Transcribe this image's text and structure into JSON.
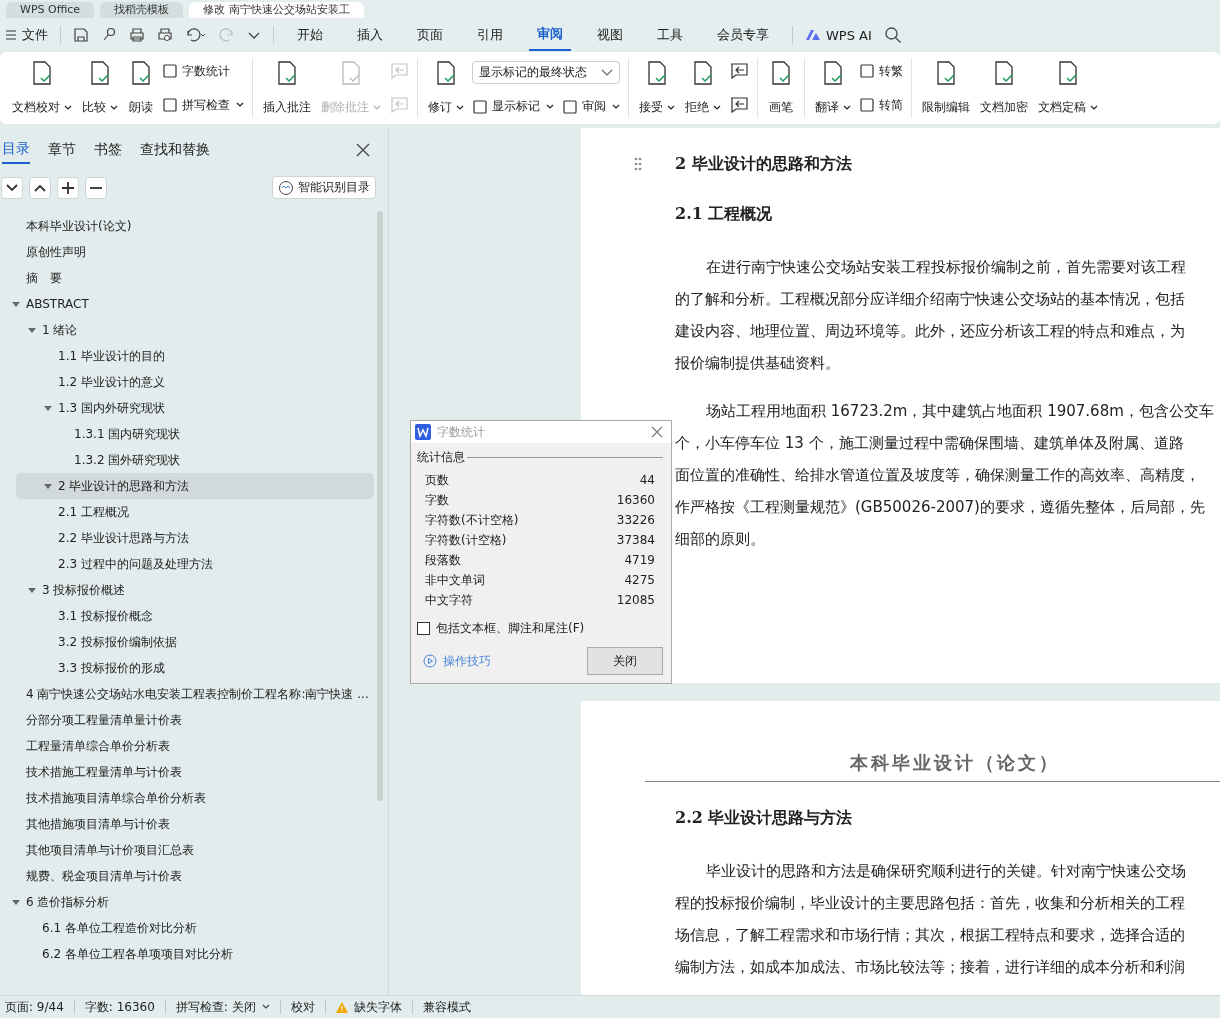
{
  "app_tabs": [
    {
      "label": "WPS Office",
      "selected": false
    },
    {
      "label": "找稻壳模板",
      "selected": false
    },
    {
      "label": "修改 南宁快速公交场站安装工",
      "selected": true
    }
  ],
  "menu": {
    "file": "文件",
    "tabs": [
      {
        "label": "开始",
        "selected": false
      },
      {
        "label": "插入",
        "selected": false
      },
      {
        "label": "页面",
        "selected": false
      },
      {
        "label": "引用",
        "selected": false
      },
      {
        "label": "审阅",
        "selected": true
      },
      {
        "label": "视图",
        "selected": false
      },
      {
        "label": "工具",
        "selected": false
      },
      {
        "label": "会员专享",
        "selected": false
      }
    ],
    "ai": "WPS AI"
  },
  "ribbon": {
    "groups": [
      {
        "items": [
          {
            "kind": "large",
            "label": "文档校对",
            "dropdown": true,
            "disabled": false
          },
          {
            "kind": "large",
            "label": "比较",
            "dropdown": true,
            "disabled": false
          },
          {
            "kind": "large",
            "label": "朗读",
            "dropdown": false,
            "disabled": false
          },
          {
            "kind": "column",
            "items": [
              {
                "kind": "small",
                "label": "字数统计",
                "dropdown": false
              },
              {
                "kind": "small",
                "label": "拼写检查",
                "dropdown": true
              }
            ]
          }
        ]
      },
      {
        "items": [
          {
            "kind": "large",
            "label": "插入批注",
            "dropdown": false,
            "disabled": false
          },
          {
            "kind": "large",
            "label": "删除批注",
            "dropdown": true,
            "disabled": true
          },
          {
            "kind": "column",
            "items": [
              {
                "kind": "icon",
                "disabled": true
              },
              {
                "kind": "icon",
                "disabled": true
              }
            ]
          }
        ]
      },
      {
        "items": [
          {
            "kind": "large",
            "label": "修订",
            "dropdown": true,
            "disabled": false
          },
          {
            "kind": "column",
            "items": [
              {
                "kind": "select",
                "value": "显示标记的最终状态"
              },
              {
                "kind": "row",
                "items": [
                  {
                    "label": "显示标记",
                    "dropdown": true
                  },
                  {
                    "label": "审阅",
                    "dropdown": true
                  }
                ]
              }
            ]
          }
        ]
      },
      {
        "items": [
          {
            "kind": "large",
            "label": "接受",
            "dropdown": true,
            "disabled": false
          },
          {
            "kind": "large",
            "label": "拒绝",
            "dropdown": true,
            "disabled": false
          },
          {
            "kind": "column",
            "items": [
              {
                "kind": "icon",
                "disabled": false
              },
              {
                "kind": "icon",
                "disabled": false
              }
            ]
          }
        ]
      },
      {
        "items": [
          {
            "kind": "large",
            "label": "画笔",
            "dropdown": false,
            "disabled": false
          }
        ]
      },
      {
        "items": [
          {
            "kind": "large",
            "label": "翻译",
            "dropdown": true,
            "disabled": false
          },
          {
            "kind": "column",
            "items": [
              {
                "kind": "small",
                "label": "转繁",
                "dropdown": false
              },
              {
                "kind": "small",
                "label": "转简",
                "dropdown": false
              }
            ]
          }
        ]
      },
      {
        "items": [
          {
            "kind": "large",
            "label": "限制编辑",
            "dropdown": false,
            "disabled": false
          },
          {
            "kind": "large",
            "label": "文档加密",
            "dropdown": false,
            "disabled": false
          },
          {
            "kind": "large",
            "label": "文档定稿",
            "dropdown": true,
            "disabled": false
          }
        ]
      }
    ]
  },
  "sidebar": {
    "tabs": [
      {
        "label": "目录",
        "selected": true
      },
      {
        "label": "章节",
        "selected": false
      },
      {
        "label": "书签",
        "selected": false
      },
      {
        "label": "查找和替换",
        "selected": false
      }
    ],
    "smart_button": "智能识别目录",
    "toc": [
      {
        "label": "本科毕业设计(论文)",
        "selected": false
      },
      {
        "label": "原创性声明",
        "selected": false
      },
      {
        "label": "摘　要",
        "selected": false
      },
      {
        "label": "ABSTRACT",
        "selected": false,
        "expanded": true,
        "children": [
          {
            "label": "1  绪论",
            "selected": false,
            "expanded": true,
            "children": [
              {
                "label": "1.1  毕业设计的目的",
                "selected": false
              },
              {
                "label": "1.2  毕业设计的意义",
                "selected": false
              },
              {
                "label": "1.3  国内外研究现状",
                "selected": false,
                "expanded": true,
                "children": [
                  {
                    "label": "1.3.1  国内研究现状",
                    "selected": false
                  },
                  {
                    "label": "1.3.2  国外研究现状",
                    "selected": false
                  }
                ]
              }
            ]
          },
          {
            "label": "2  毕业设计的思路和方法",
            "selected": true,
            "expanded": true,
            "children": [
              {
                "label": "2.1  工程概况",
                "selected": false
              },
              {
                "label": "2.2  毕业设计思路与方法",
                "selected": false
              },
              {
                "label": "2.3  过程中的问题及处理方法",
                "selected": false
              }
            ]
          },
          {
            "label": "3  投标报价概述",
            "selected": false,
            "expanded": true,
            "children": [
              {
                "label": "3.1  投标报价概念",
                "selected": false
              },
              {
                "label": "3.2  投标报价编制依据",
                "selected": false
              },
              {
                "label": "3.3  投标报价的形成",
                "selected": false
              }
            ]
          }
        ]
      },
      {
        "label": "4 南宁快速公交场站水电安装工程表控制价工程名称:南宁快速 ...",
        "selected": false
      },
      {
        "label": "分部分项工程量清单量计价表",
        "selected": false
      },
      {
        "label": "工程量清单综合单价分析表",
        "selected": false
      },
      {
        "label": "技术措施工程量清单与计价表",
        "selected": false
      },
      {
        "label": "技术措施项目清单综合单价分析表",
        "selected": false
      },
      {
        "label": "其他措施项目清单与计价表",
        "selected": false
      },
      {
        "label": "其他项目清单与计价项目汇总表",
        "selected": false
      },
      {
        "label": "规费、税金项目清单与计价表",
        "selected": false
      },
      {
        "label": "6  造价指标分析",
        "selected": false,
        "expanded": true,
        "children": [
          {
            "label": "6.1  各单位工程造价对比分析",
            "selected": false
          },
          {
            "label": "6.2  各单位工程各单项项目对比分析",
            "selected": false
          }
        ]
      }
    ]
  },
  "document": {
    "pages": [
      {
        "blocks": [
          {
            "kind": "h1",
            "text": "2  毕业设计的思路和方法"
          },
          {
            "kind": "h2",
            "text": "2.1  工程概况"
          },
          {
            "kind": "para",
            "lines": [
              "在进行南宁快速公交场站安装工程投标报价编制之前，首先需要对该工程",
              "的了解和分析。工程概况部分应详细介绍南宁快速公交场站的基本情况，包括",
              "建设内容、地理位置、周边环境等。此外，还应分析该工程的特点和难点，为",
              "报价编制提供基础资料。"
            ]
          },
          {
            "kind": "para",
            "lines": [
              "场站工程用地面积 16723.2m，其中建筑占地面积 1907.68m，包含公交车",
              "个，小车停车位 13 个，施工测量过程中需确保围墙、建筑单体及附属、道路",
              "面位置的准确性、给排水管道位置及坡度等，确保测量工作的高效率、高精度，",
              "作严格按《工程测量规范》(GB50026-2007)的要求，遵循先整体，后局部，先",
              "细部的原则。"
            ]
          }
        ]
      },
      {
        "blocks": [
          {
            "kind": "header",
            "text": "本科毕业设计（论文）"
          },
          {
            "kind": "h2",
            "text": "2.2  毕业设计思路与方法"
          },
          {
            "kind": "para",
            "lines": [
              "毕业设计的思路和方法是确保研究顺利进行的关键。针对南宁快速公交场",
              "程的投标报价编制，毕业设计的主要思路包括：首先，收集和分析相关的工程",
              "场信息，了解工程需求和市场行情；其次，根据工程特点和要求，选择合适的",
              "编制方法，如成本加成法、市场比较法等；接着，进行详细的成本分析和利润"
            ]
          }
        ]
      }
    ]
  },
  "dialog": {
    "title": "字数统计",
    "section": "统计信息",
    "rows": [
      {
        "label": "页数",
        "value": "44"
      },
      {
        "label": "字数",
        "value": "16360"
      },
      {
        "label": "字符数(不计空格)",
        "value": "33226"
      },
      {
        "label": "字符数(计空格)",
        "value": "37384"
      },
      {
        "label": "段落数",
        "value": "4719"
      },
      {
        "label": "非中文单词",
        "value": "4275"
      },
      {
        "label": "中文字符",
        "value": "12085"
      }
    ],
    "checkbox": {
      "label": "包括文本框、脚注和尾注(F)",
      "checked": false
    },
    "tips_link": "操作技巧",
    "close_button": "关闭"
  },
  "status_bar": [
    {
      "kind": "text",
      "text": "页面: 9/44"
    },
    {
      "kind": "text",
      "text": "字数: 16360"
    },
    {
      "kind": "dropdown",
      "text": "拼写检查: 关闭"
    },
    {
      "kind": "text",
      "text": "校对"
    },
    {
      "kind": "warning",
      "text": "缺失字体"
    },
    {
      "kind": "text",
      "text": "兼容模式"
    }
  ]
}
